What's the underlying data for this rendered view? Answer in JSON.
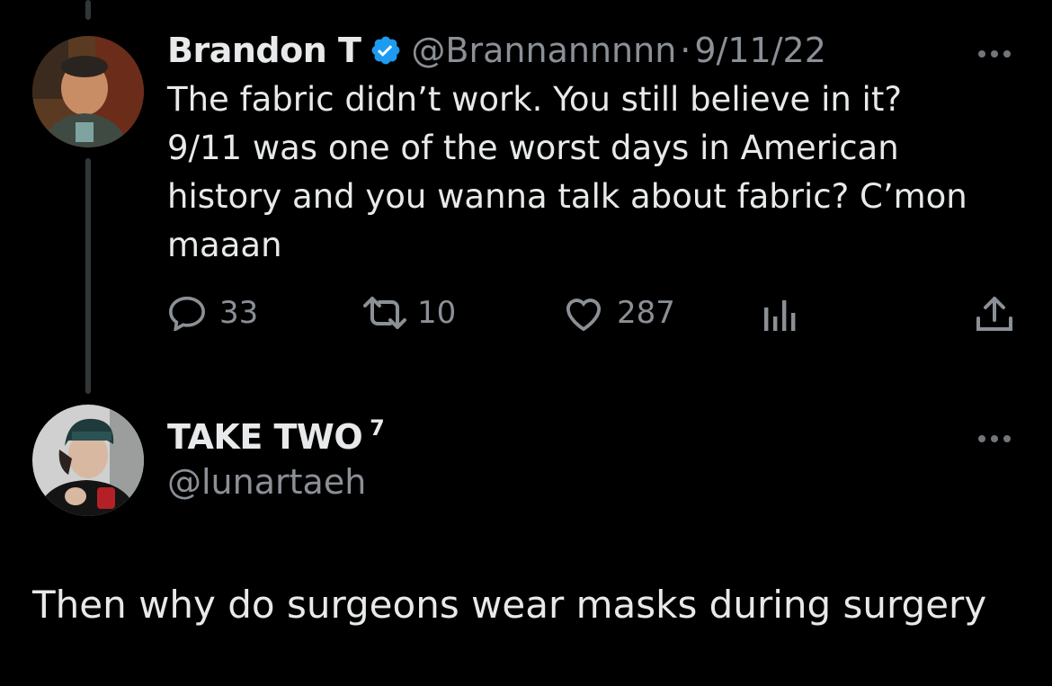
{
  "tweet": {
    "display_name": "Brandon T",
    "verified_icon": "verified-badge-icon",
    "handle": "@Brannannnnn",
    "separator": "·",
    "date": "9/11/22",
    "text": "The fabric didn’t work. You still believe in it?\n9/11 was one of the worst days in American\nhistory and you wanna talk about fabric? C’mon\nmaaan",
    "actions": {
      "replies": "33",
      "retweets": "10",
      "likes": "287"
    },
    "accent_color": "#1d9bf0"
  },
  "reply": {
    "display_name": "TAKE TWO",
    "superscript": "7",
    "handle": "@lunartaeh",
    "text": "Then why do surgeons wear masks during surgery"
  },
  "colors": {
    "background": "#000000",
    "primary_text": "#e7e9ea",
    "secondary_text": "#8b9096",
    "thread_line": "#333639"
  }
}
